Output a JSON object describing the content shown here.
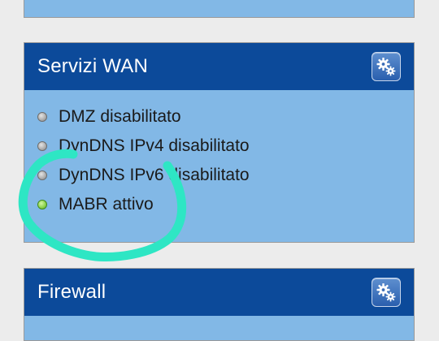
{
  "panels": {
    "wan": {
      "title": "Servizi WAN",
      "items": [
        {
          "label": "DMZ disabilitato",
          "status": "off"
        },
        {
          "label": "DynDNS IPv4 disabilitato",
          "status": "off"
        },
        {
          "label": "DynDNS IPv6 disabilitato",
          "status": "off"
        },
        {
          "label": "MABR attivo",
          "status": "on"
        }
      ]
    },
    "firewall": {
      "title": "Firewall"
    }
  },
  "icons": {
    "settings": "gear-icon",
    "status_off": "grey-dot-icon",
    "status_on": "green-dot-icon"
  },
  "colors": {
    "header": "#0c4a9a",
    "panel_body": "#82b8e6",
    "status_on": "#8fd54e",
    "status_off": "#b0b0b0",
    "highlight": "#2ee6c4"
  }
}
